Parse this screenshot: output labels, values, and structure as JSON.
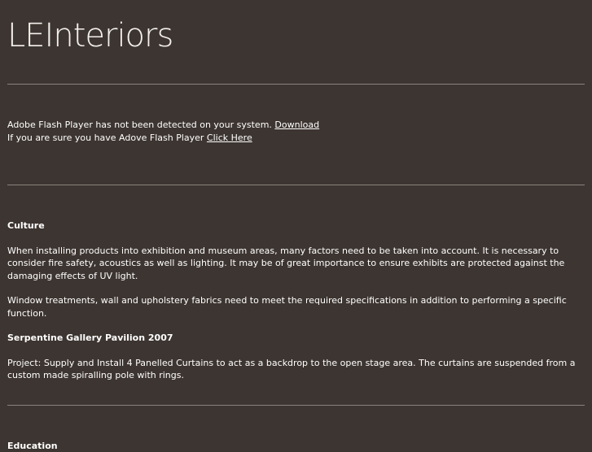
{
  "header": {
    "logo_text": "LEInteriors"
  },
  "flash": {
    "line1_text": "Adobe Flash Player has not been detected on your system. ",
    "line1_link": "Download",
    "line2_text": "If you are sure you have Adove Flash Player ",
    "line2_link": "Click Here"
  },
  "sections": [
    {
      "title": "Culture",
      "paragraphs": [
        "When installing products into exhibition and museum areas, many factors need to be taken into account. It is necessary to consider fire safety, acoustics as well as lighting. It may be of great importance to ensure exhibits are protected against the damaging effects of UV light.",
        "Window treatments, wall and upholstery fabrics need to meet the required specifications in addition to performing a specific function."
      ],
      "subtitle": "Serpentine Gallery Pavilion 2007",
      "project": "Project: Supply and Install 4 Panelled Curtains to act as a backdrop to the open stage area. The curtains are suspended from a custom made spiralling pole with rings."
    },
    {
      "title": "Education"
    }
  ]
}
